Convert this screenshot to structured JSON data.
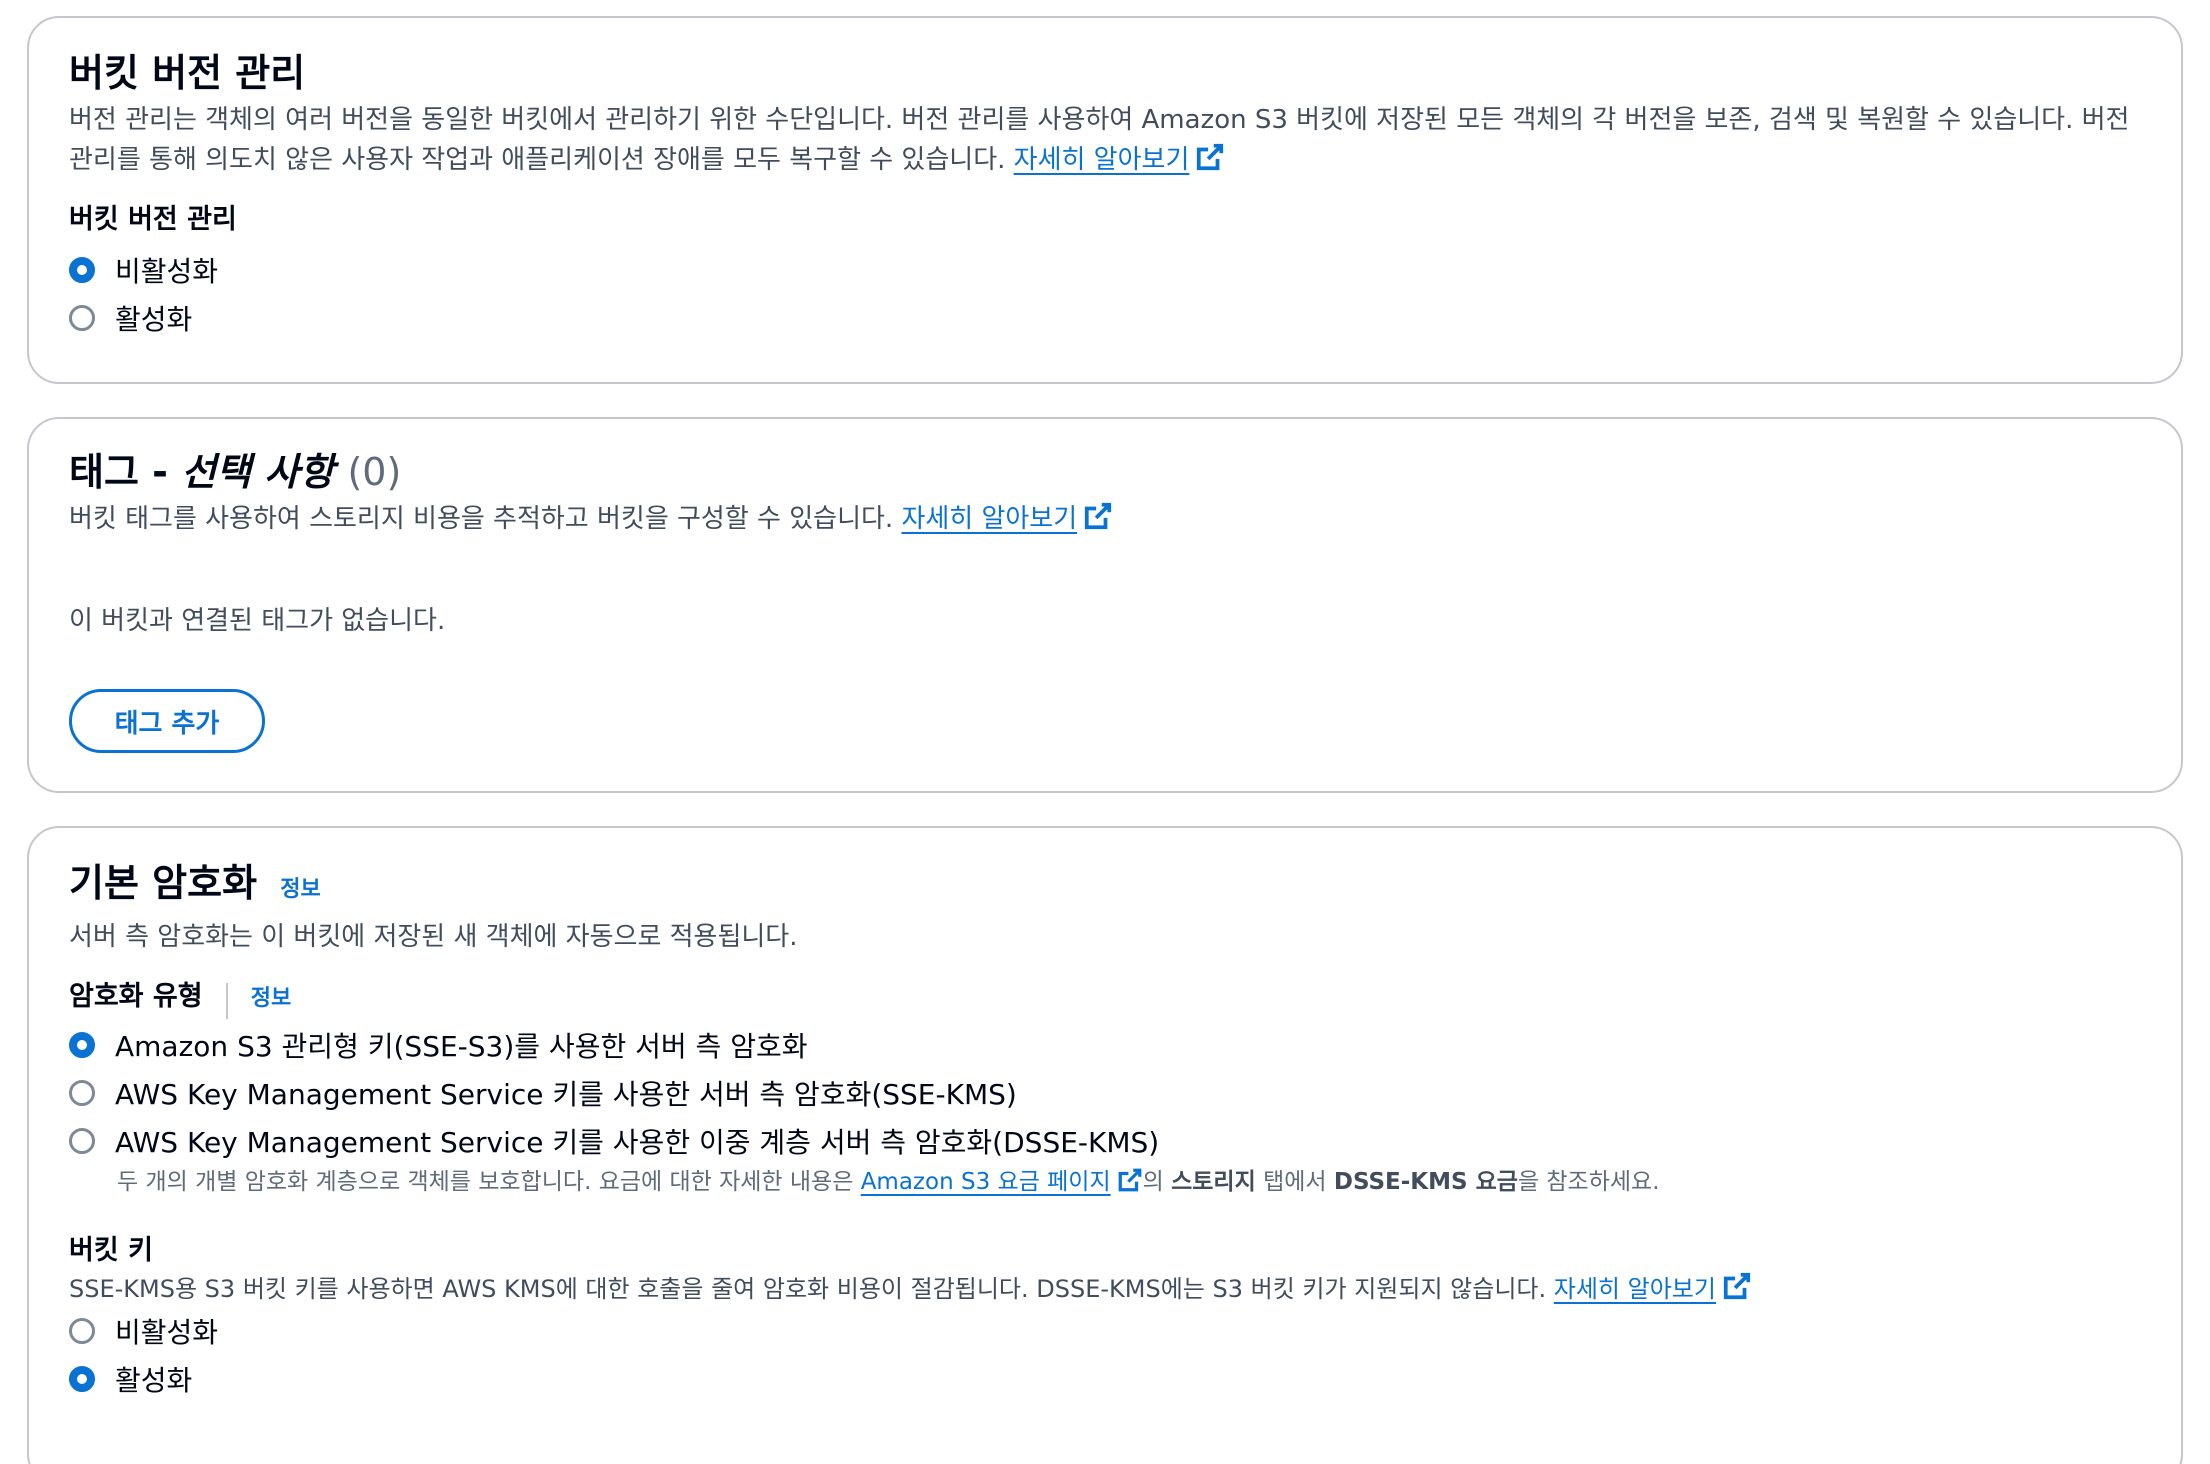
{
  "versioning": {
    "title": "버킷 버전 관리",
    "description_line1": "버전 관리는 객체의 여러 버전을 동일한 버킷에서 관리하기 위한 수단입니다. 버전 관리를 사용하여 Amazon S3 버킷에 저장된 모든 객체의 각 버전을 보존, 검색 및 복원할 수 있습니다. 버전",
    "description_line2": "관리를 통해 의도치 않은 사용자 작업과 애플리케이션 장애를 모두 복구할 수 있습니다.",
    "learn_more": "자세히 알아보기",
    "field_label": "버킷 버전 관리",
    "options": [
      "비활성화",
      "활성화"
    ],
    "selected": "비활성화"
  },
  "tags": {
    "title": "태그 -",
    "title_optional": "선택 사항",
    "count": "(0)",
    "description": "버킷 태그를 사용하여 스토리지 비용을 추적하고 버킷을 구성할 수 있습니다.",
    "learn_more": "자세히 알아보기",
    "empty_message": "이 버킷과 연결된 태그가 없습니다.",
    "add_button": "태그 추가"
  },
  "encryption": {
    "title": "기본 암호화",
    "info": "정보",
    "description": "서버 측 암호화는 이 버킷에 저장된 새 객체에 자동으로 적용됩니다.",
    "type_label": "암호화 유형",
    "type_info": "정보",
    "options": [
      "Amazon S3 관리형 키(SSE-S3)를 사용한 서버 측 암호화",
      "AWS Key Management Service 키를 사용한 서버 측 암호화(SSE-KMS)",
      "AWS Key Management Service 키를 사용한 이중 계층 서버 측 암호화(DSSE-KMS)"
    ],
    "selected": "Amazon S3 관리형 키(SSE-S3)를 사용한 서버 측 암호화",
    "dsse_desc_prefix": "두 개의 개별 암호화 계층으로 객체를 보호합니다. 요금에 대한 자세한 내용은",
    "dsse_desc_link": "Amazon S3 요금 페이지",
    "dsse_desc_mid1": "의",
    "dsse_desc_bold1": "스토리지",
    "dsse_desc_mid2": "탭에서",
    "dsse_desc_bold2": "DSSE-KMS 요금",
    "dsse_desc_suffix": "을 참조하세요.",
    "bucket_key_label": "버킷 키",
    "bucket_key_desc": "SSE-KMS용 S3 버킷 키를 사용하면 AWS KMS에 대한 호출을 줄여 암호화 비용이 절감됩니다. DSSE-KMS에는 S3 버킷 키가 지원되지 않습니다.",
    "bucket_key_learn_more": "자세히 알아보기",
    "bucket_key_options": [
      "비활성화",
      "활성화"
    ],
    "bucket_key_selected": "활성화"
  },
  "colors": {
    "accent": "#0972d3",
    "border": "#c6c6cd",
    "text": "#000716",
    "secondary_text": "#414d5c"
  }
}
